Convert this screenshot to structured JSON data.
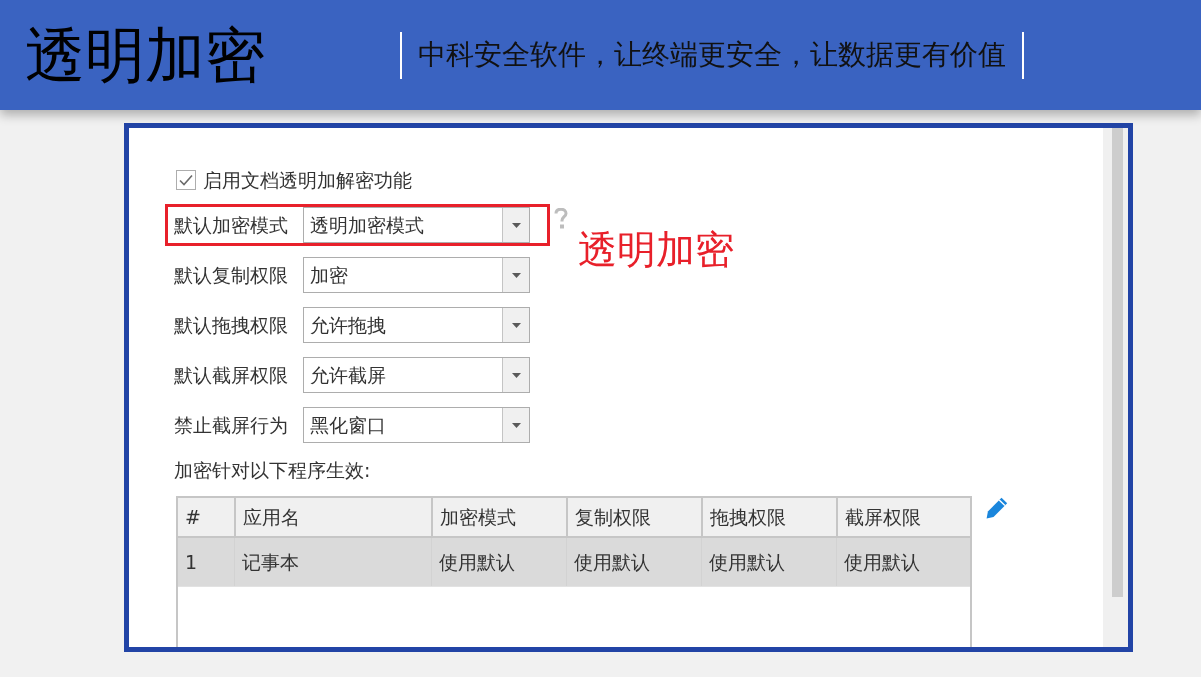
{
  "header": {
    "title": "透明加密",
    "slogan": "中科安全软件，让终端更安全，让数据更有价值"
  },
  "settings": {
    "enable_checkbox": {
      "label": "启用文档透明加解密功能",
      "checked": true
    },
    "fields": [
      {
        "label": "默认加密模式",
        "value": "透明加密模式",
        "highlighted": true
      },
      {
        "label": "默认复制权限",
        "value": "加密",
        "highlighted": false
      },
      {
        "label": "默认拖拽权限",
        "value": "允许拖拽",
        "highlighted": false
      },
      {
        "label": "默认截屏权限",
        "value": "允许截屏",
        "highlighted": false
      },
      {
        "label": "禁止截屏行为",
        "value": "黑化窗口",
        "highlighted": false
      }
    ],
    "programs_label": "加密针对以下程序生效:",
    "table": {
      "columns": [
        "#",
        "应用名",
        "加密模式",
        "复制权限",
        "拖拽权限",
        "截屏权限"
      ],
      "rows": [
        {
          "selected": true,
          "cells": [
            "1",
            "记事本",
            "使用默认",
            "使用默认",
            "使用默认",
            "使用默认"
          ]
        }
      ]
    }
  },
  "annotation": {
    "text": "透明加密"
  }
}
